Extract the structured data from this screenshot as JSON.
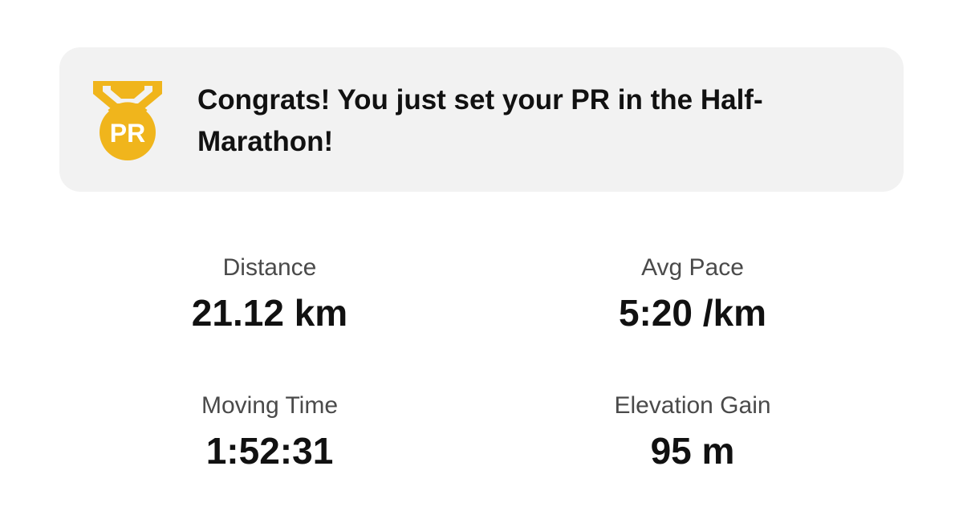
{
  "pr_banner": {
    "medal_text": "PR",
    "message": "Congrats! You just set your PR in the Half-Marathon!",
    "accent_color": "#F0B51C",
    "background_color": "#F2F2F2"
  },
  "stats": [
    {
      "label": "Distance",
      "value": "21.12 km"
    },
    {
      "label": "Avg Pace",
      "value": "5:20 /km"
    },
    {
      "label": "Moving Time",
      "value": "1:52:31"
    },
    {
      "label": "Elevation Gain",
      "value": "95 m"
    }
  ]
}
